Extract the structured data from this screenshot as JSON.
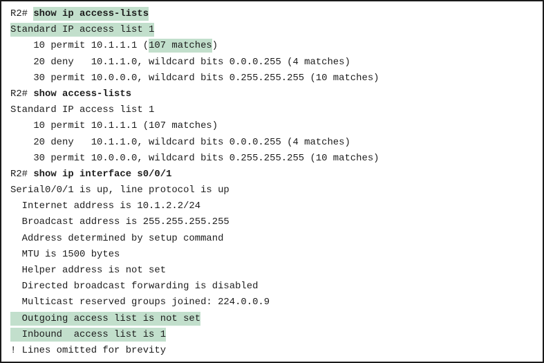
{
  "terminal": {
    "lines": [
      {
        "prompt": "R2# ",
        "command": "show ip access-lists"
      },
      {
        "text": "Standard IP access list 1"
      },
      {
        "pre": "    10 permit 10.1.1.1 (",
        "mid": "107 matches",
        "post": ")"
      },
      {
        "text": "    20 deny   10.1.1.0, wildcard bits 0.0.0.255 (4 matches)"
      },
      {
        "text": "    30 permit 10.0.0.0, wildcard bits 0.255.255.255 (10 matches)"
      },
      {
        "prompt": "R2# ",
        "command": "show access-lists"
      },
      {
        "text": "Standard IP access list 1"
      },
      {
        "text": "    10 permit 10.1.1.1 (107 matches)"
      },
      {
        "text": "    20 deny   10.1.1.0, wildcard bits 0.0.0.255 (4 matches)"
      },
      {
        "text": "    30 permit 10.0.0.0, wildcard bits 0.255.255.255 (10 matches)"
      },
      {
        "prompt": "R2# ",
        "command": "show ip interface s0/0/1"
      },
      {
        "text": "Serial0/0/1 is up, line protocol is up"
      },
      {
        "text": "  Internet address is 10.1.2.2/24"
      },
      {
        "text": "  Broadcast address is 255.255.255.255"
      },
      {
        "text": "  Address determined by setup command"
      },
      {
        "text": "  MTU is 1500 bytes"
      },
      {
        "text": "  Helper address is not set"
      },
      {
        "text": "  Directed broadcast forwarding is disabled"
      },
      {
        "text": "  Multicast reserved groups joined: 224.0.0.9"
      },
      {
        "text": "  Outgoing access list is not set"
      },
      {
        "text": "  Inbound  access list is 1"
      },
      {
        "text": "! Lines omitted for brevity"
      }
    ]
  },
  "colors": {
    "highlight": "#c2dfcc",
    "text": "#1c1c1c",
    "border": "#1a1a1a"
  }
}
